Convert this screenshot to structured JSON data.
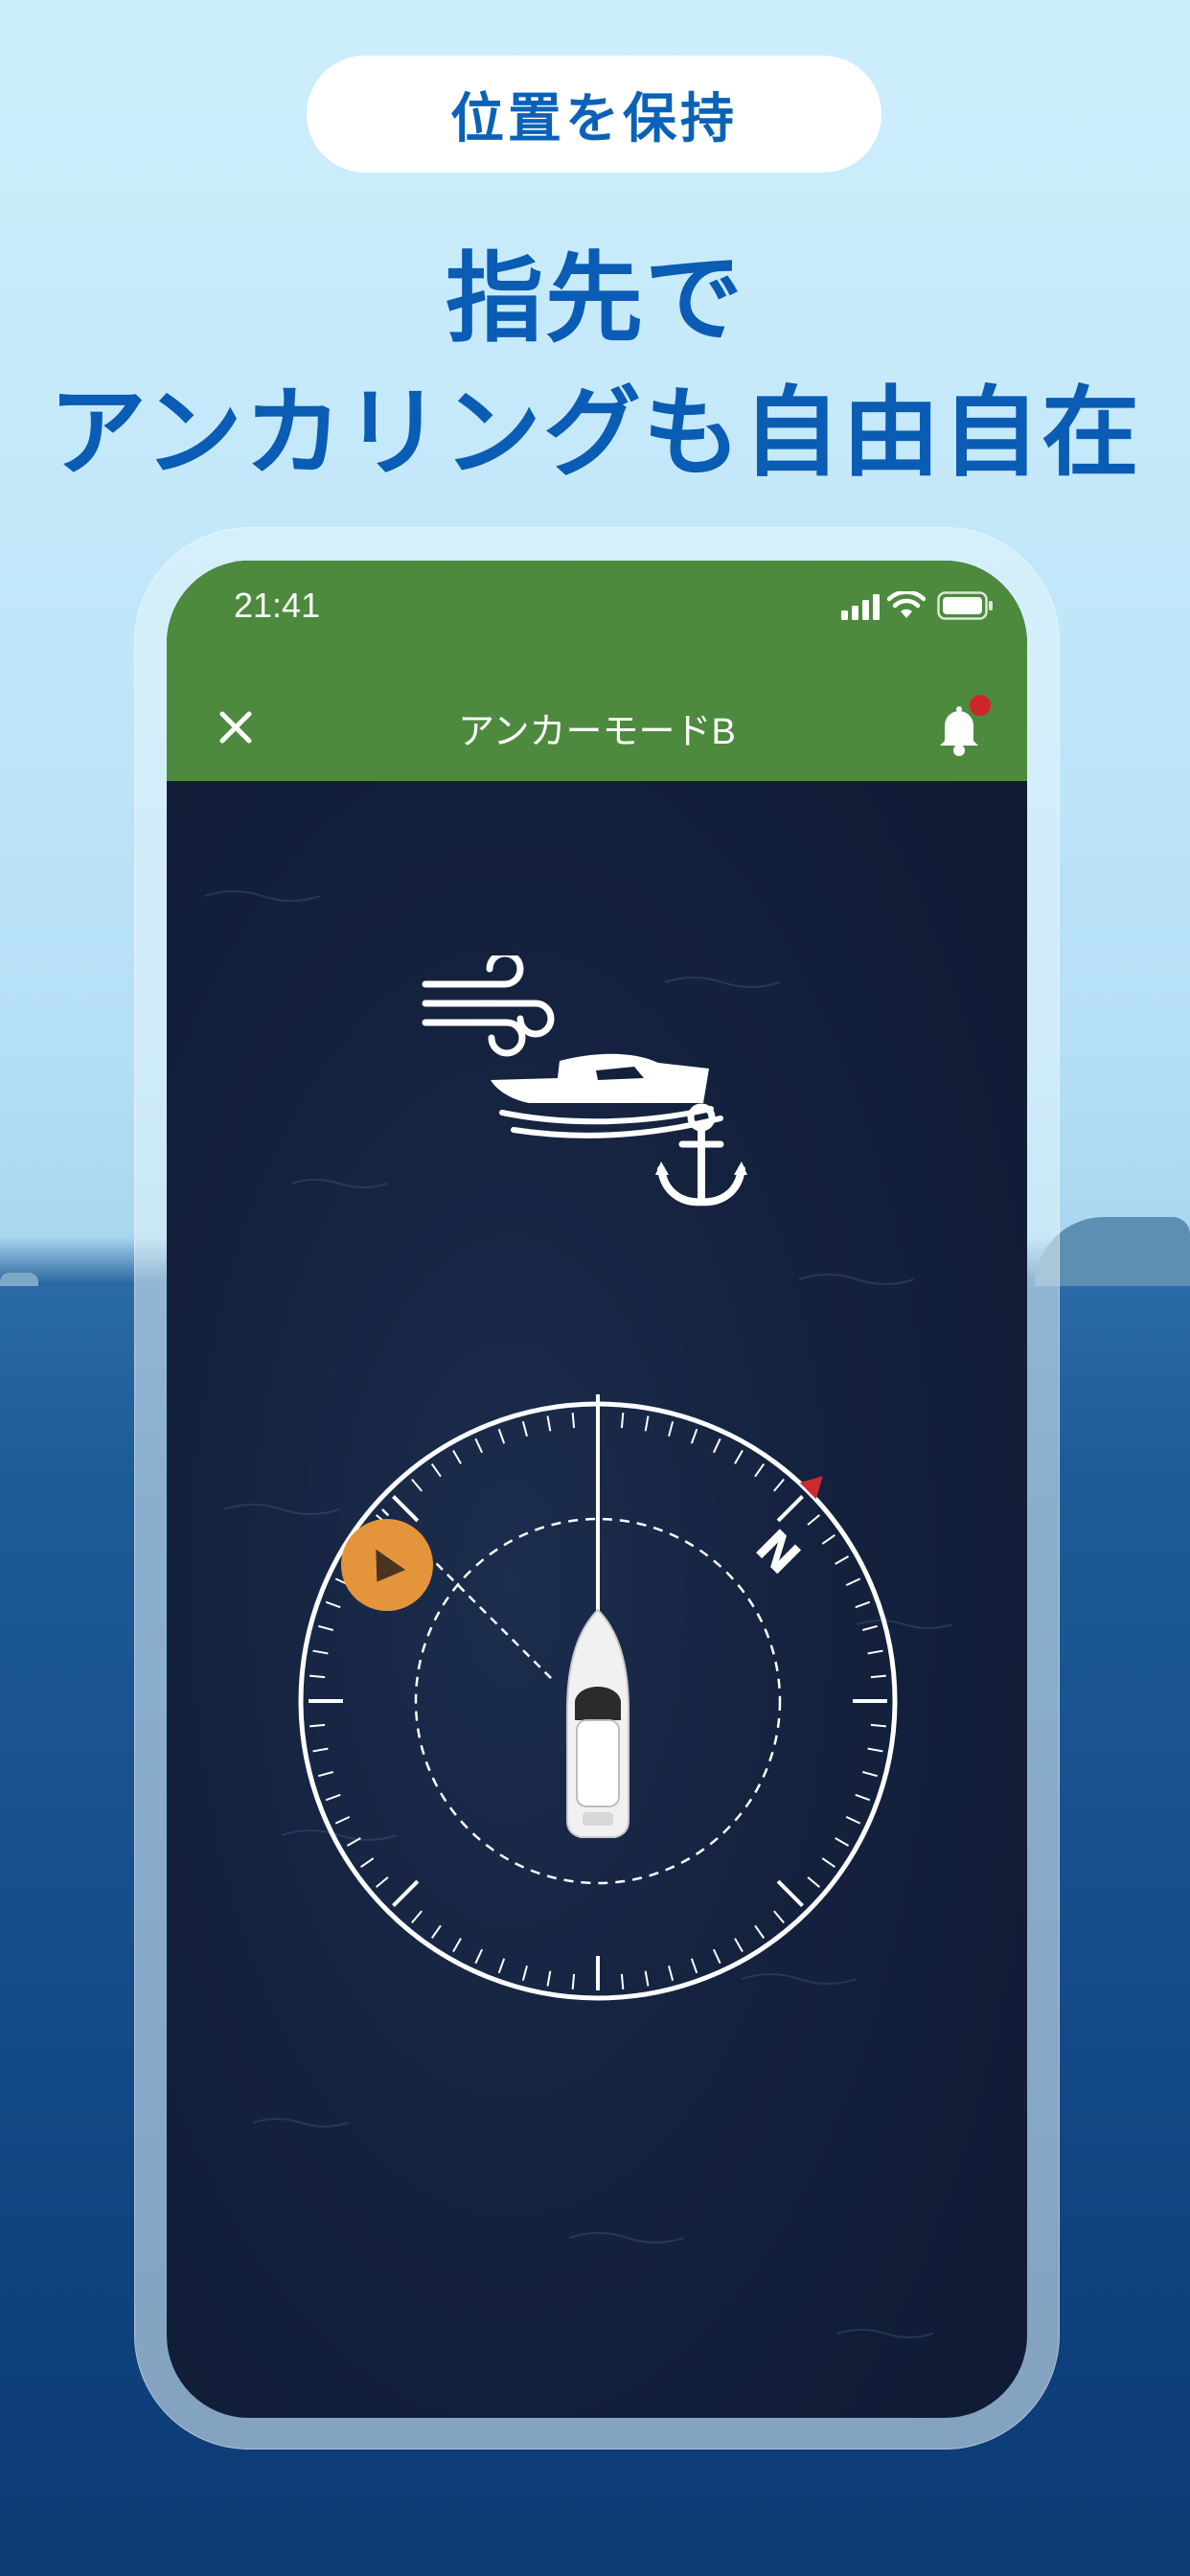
{
  "promo": {
    "badge": "位置を保持",
    "headline_line1": "指先で",
    "headline_line2": "アンカリングも自由自在"
  },
  "phone": {
    "status_time": "21:41",
    "nav_title": "アンカーモードB",
    "icons": [
      "close-icon",
      "bell-icon",
      "wind-icon",
      "boat-icon",
      "anchor-icon",
      "compass-dial",
      "north-marker-icon",
      "waypoint-marker-icon"
    ],
    "compass_heading_label": "N",
    "colors": {
      "statusbar": "#4d8a3d",
      "screen_bg": "#14213d",
      "headline": "#0a5cb4",
      "waypoint": "#e4953b",
      "north_marker": "#cf2b2b",
      "notification_dot": "#d0242a"
    }
  }
}
